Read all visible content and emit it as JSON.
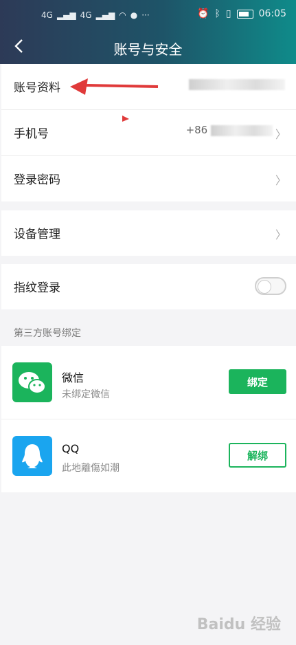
{
  "statusbar": {
    "time": "06:05",
    "net1": "4G",
    "net2": "4G",
    "more": "···"
  },
  "header": {
    "title": "账号与安全",
    "back_icon": "back-chevron-icon"
  },
  "rows": [
    {
      "label": "账号资料",
      "value": ""
    },
    {
      "label": "手机号",
      "value": "+86 "
    },
    {
      "label": "登录密码",
      "value": ""
    }
  ],
  "device": {
    "label": "设备管理"
  },
  "fingerprint": {
    "label": "指纹登录",
    "enabled": false
  },
  "third_party": {
    "title": "第三方账号绑定",
    "accounts": [
      {
        "name": "微信",
        "status": "未绑定微信",
        "button": "绑定",
        "color": "#1bb45c"
      },
      {
        "name": "QQ",
        "status": "此地離傷如潮",
        "button": "解绑",
        "color": "#1aa5ef"
      }
    ]
  },
  "watermark": "Baidu 经验"
}
